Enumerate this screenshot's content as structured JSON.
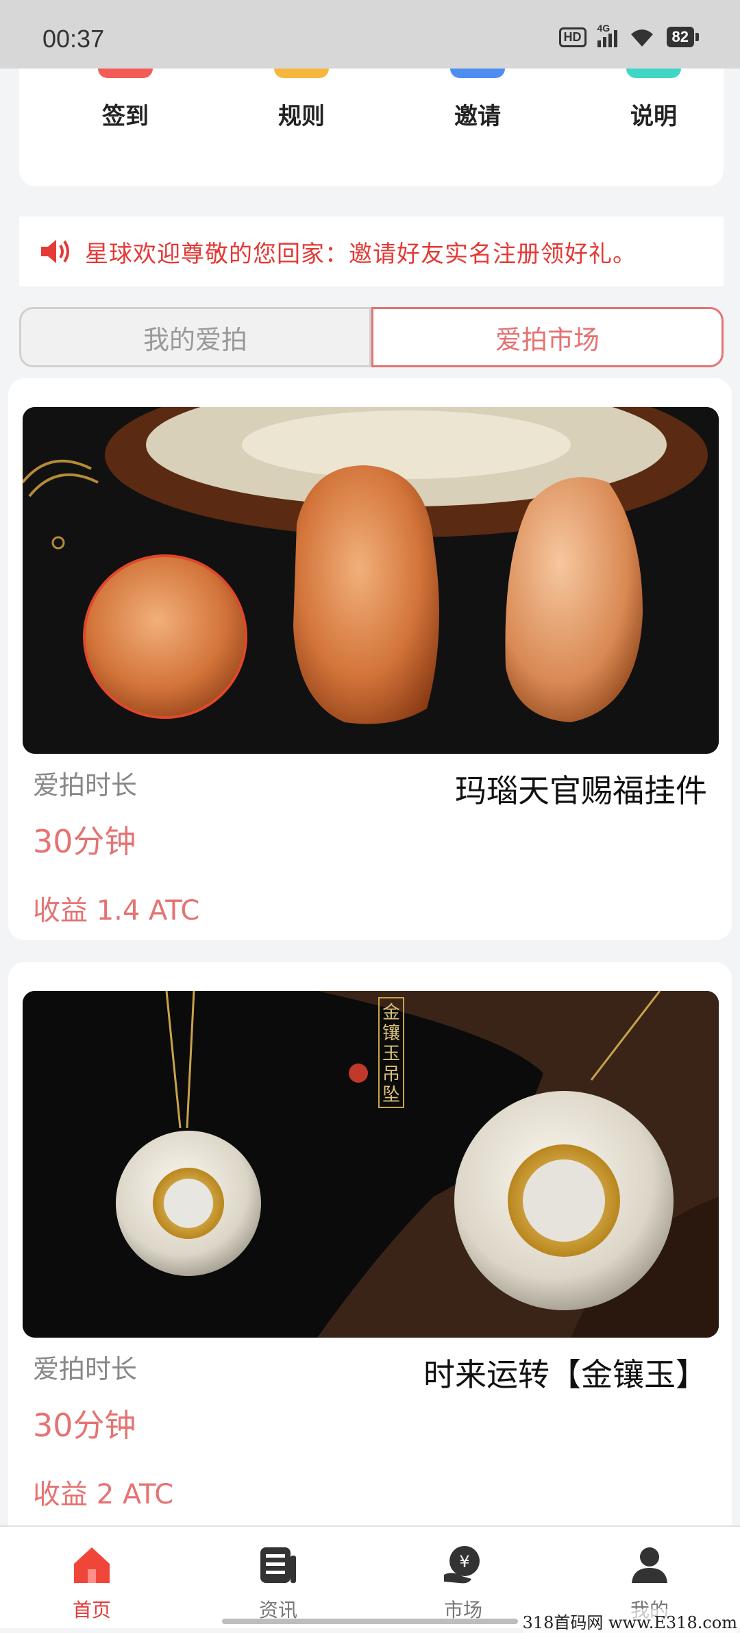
{
  "status_bar": {
    "time": "00:37",
    "network": "4G",
    "hd": "HD",
    "battery": "82"
  },
  "quick_actions": [
    {
      "label": "签到",
      "color": "#f25c54"
    },
    {
      "label": "规则",
      "color": "#f7b63d"
    },
    {
      "label": "邀请",
      "color": "#4d8ef0"
    },
    {
      "label": "说明",
      "color": "#3fd6c5"
    }
  ],
  "notice": {
    "text": "星球欢迎尊敬的您回家：邀请好友实名注册领好礼。"
  },
  "tabs": [
    {
      "label": "我的爱拍"
    },
    {
      "label": "爱拍市场"
    }
  ],
  "items": [
    {
      "name": "玛瑙天官赐福挂件",
      "duration_label": "爱拍时长",
      "duration_value": "30分钟",
      "reward": "收益 1.4 ATC"
    },
    {
      "name": "时来运转【金镶玉】",
      "duration_label": "爱拍时长",
      "duration_value": "30分钟",
      "reward": "收益 2 ATC",
      "image_text": "金镶玉吊坠"
    }
  ],
  "bottom_nav": [
    {
      "label": "首页",
      "active": true
    },
    {
      "label": "资讯",
      "active": false
    },
    {
      "label": "市场",
      "active": false
    },
    {
      "label": "我的",
      "active": false
    }
  ],
  "watermark": "318首码网 www.E318.com"
}
